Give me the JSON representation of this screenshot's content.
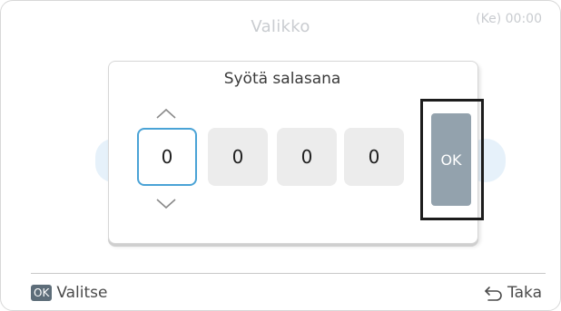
{
  "header": {
    "title": "Valikko",
    "clock": "(Ke) 00:00"
  },
  "dialog": {
    "title": "Syötä salasana",
    "digits": [
      "0",
      "0",
      "0",
      "0"
    ],
    "active_digit_index": 0,
    "ok_label": "OK"
  },
  "footer": {
    "select_chip": "OK",
    "select_label": "Valitse",
    "back_label": "Taka"
  },
  "colors": {
    "accent": "#4aa3d6",
    "ok_button": "#93a2ad",
    "digit_bg": "#ececec",
    "chip_bg": "#5d6d79"
  },
  "icons": {
    "increment": "chevron-up-icon",
    "decrement": "chevron-down-icon",
    "back": "back-arrow-icon"
  }
}
